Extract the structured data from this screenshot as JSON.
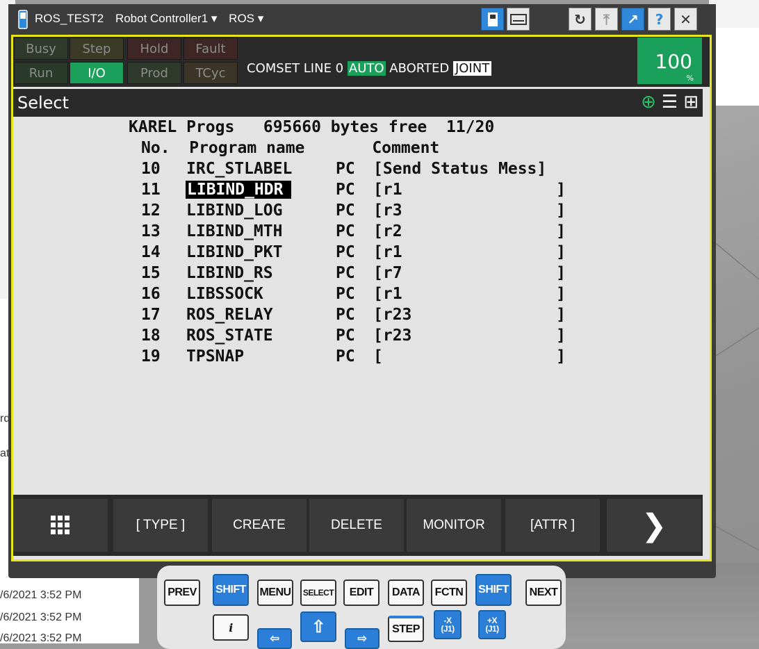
{
  "window": {
    "title_parts": [
      "ROS_TEST2",
      "Robot Controller1 ▾",
      "ROS ▾"
    ]
  },
  "status": {
    "lamps": [
      {
        "label": "Busy",
        "active": false
      },
      {
        "label": "Step",
        "active": false
      },
      {
        "label": "Hold",
        "active": false
      },
      {
        "label": "Fault",
        "active": false
      },
      {
        "label": "Run",
        "active": false
      },
      {
        "label": "I/O",
        "active": true
      },
      {
        "label": "Prod",
        "active": false
      },
      {
        "label": "TCyc",
        "active": false
      }
    ],
    "line_prefix": "COMSET LINE 0",
    "mode": "AUTO",
    "state": "ABORTED",
    "coord": "JOINT",
    "override_value": "100",
    "override_unit": "%"
  },
  "screen": {
    "title": "Select"
  },
  "listing": {
    "header": "KAREL Progs   695660 bytes free  11/20",
    "columns": "No.  Program name       Comment",
    "rows": [
      {
        "no": "10",
        "name": "IRC_STLABEL",
        "type": "PC",
        "comment": "[Send Status Mess]"
      },
      {
        "no": "11",
        "name": "LIBIND_HDR",
        "type": "PC",
        "comment": "[r1                ]"
      },
      {
        "no": "12",
        "name": "LIBIND_LOG",
        "type": "PC",
        "comment": "[r3                ]"
      },
      {
        "no": "13",
        "name": "LIBIND_MTH",
        "type": "PC",
        "comment": "[r2                ]"
      },
      {
        "no": "14",
        "name": "LIBIND_PKT",
        "type": "PC",
        "comment": "[r1                ]"
      },
      {
        "no": "15",
        "name": "LIBIND_RS",
        "type": "PC",
        "comment": "[r7                ]"
      },
      {
        "no": "16",
        "name": "LIBSSOCK",
        "type": "PC",
        "comment": "[r1                ]"
      },
      {
        "no": "17",
        "name": "ROS_RELAY",
        "type": "PC",
        "comment": "[r23               ]"
      },
      {
        "no": "18",
        "name": "ROS_STATE",
        "type": "PC",
        "comment": "[r23               ]"
      },
      {
        "no": "19",
        "name": "TPSNAP",
        "type": "PC",
        "comment": "[                  ]"
      }
    ],
    "selected_index": 1
  },
  "function_keys": [
    "[ TYPE ]",
    "CREATE",
    "DELETE",
    "MONITOR",
    "[ATTR ]"
  ],
  "keypad": {
    "row1": [
      "PREV",
      "SHIFT",
      "MENU",
      "SELECT",
      "EDIT",
      "DATA",
      "FCTN",
      "SHIFT",
      "NEXT"
    ],
    "row2": [
      "i",
      "STEP",
      "-X\n(J1)",
      "+X\n(J1)"
    ]
  },
  "background": {
    "timestamps": [
      "/6/2021 3:52 PM",
      "/6/2021 3:52 PM",
      "/6/2021 3:52 PM"
    ],
    "fragments": [
      "rd",
      "at"
    ]
  },
  "colors": {
    "accent_green": "#1aa05a",
    "frame_yellow": "#e6e61a",
    "key_blue": "#2b7fd8"
  }
}
